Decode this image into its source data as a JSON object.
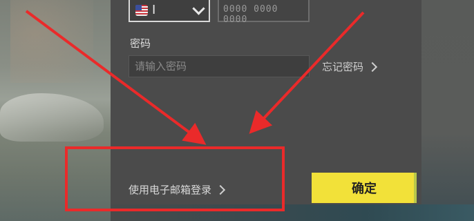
{
  "login_form": {
    "country_select": {
      "selected_value": "I",
      "flag": "us-flag-icon"
    },
    "phone_input": {
      "placeholder": "0000 0000 0000"
    },
    "password": {
      "label": "密码",
      "placeholder": "请输入密码"
    },
    "forgot_password_label": "忘记密码",
    "email_login_label": "使用电子邮箱登录",
    "confirm_label": "确定"
  },
  "colors": {
    "panel_bg": "#4b4b4b",
    "confirm_button": "#f2e139",
    "annotation_red": "#ea2a2a"
  },
  "annotations": {
    "highlight": "red rectangle around 使用电子邮箱登录",
    "arrows": "two red arrows pointing to highlighted area"
  }
}
